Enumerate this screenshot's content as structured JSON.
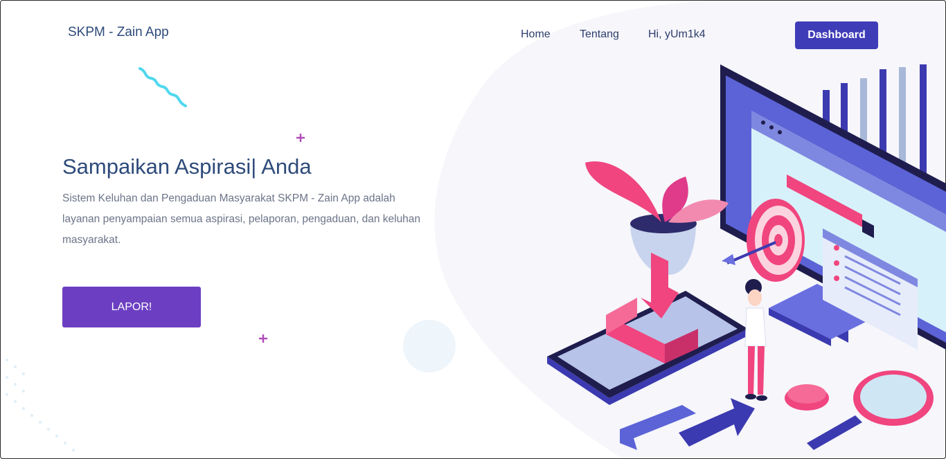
{
  "header": {
    "brand": "SKPM - Zain App",
    "nav": {
      "home": "Home",
      "about": "Tentang",
      "user_greeting": "Hi, yUm1k4"
    },
    "dashboard_label": "Dashboard"
  },
  "hero": {
    "title": "Sampaikan Aspirasi| Anda",
    "description": "Sistem Keluhan dan Pengaduan Masyarakat SKPM - Zain App adalah layanan penyampaian semua aspirasi, pelaporan, pengaduan, dan keluhan masyarakat.",
    "cta_label": "LAPOR!"
  },
  "colors": {
    "primary_button": "#3f3cb8",
    "cta_button": "#6c3fc2",
    "accent_pink": "#f0457e",
    "accent_cyan": "#4fd8ee"
  },
  "icons": {
    "plus": "plus-icon",
    "squiggle": "squiggle-decoration",
    "illustration": "isometric-report-illustration"
  }
}
